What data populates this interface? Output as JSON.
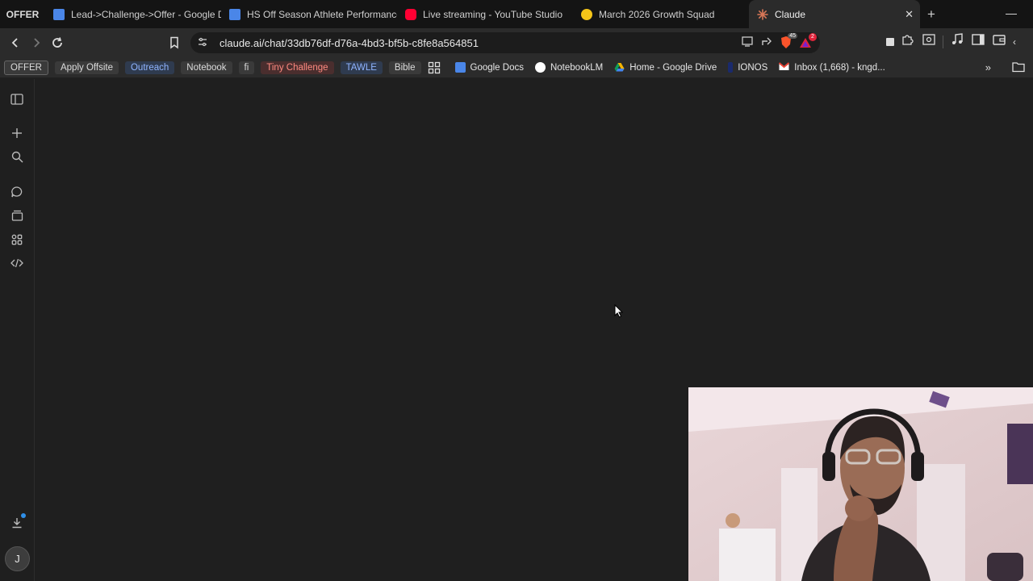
{
  "tabs": {
    "pinned_label": "OFFER",
    "items": [
      {
        "label": "Lead->Challenge->Offer - Google Dc",
        "icon": "google-docs-icon",
        "color": "#4a86e8"
      },
      {
        "label": "HS Off Season Athlete Performance F",
        "icon": "google-docs-icon",
        "color": "#4a86e8"
      },
      {
        "label": "Live streaming - YouTube Studio",
        "icon": "youtube-icon",
        "color": "#ff0033"
      },
      {
        "label": "March 2026 Growth Squad",
        "icon": "smiley-icon",
        "color": "#f5c518"
      },
      {
        "label": "Claude",
        "icon": "claude-icon",
        "color": "#d97757"
      }
    ],
    "new_tab": "+",
    "close": "✕"
  },
  "toolbar": {
    "url": "claude.ai/chat/33db76df-d76a-4bd3-bf5b-c8fe8a564851",
    "brave_badge": "45",
    "alert_badge": "2"
  },
  "bookmarks": {
    "chips": [
      {
        "label": "OFFER",
        "bg": "#3a3a3a",
        "fg": "#dcdcdc"
      },
      {
        "label": "Apply Offsite",
        "bg": "#3a3a3a",
        "fg": "#dcdcdc"
      },
      {
        "label": "Outreach",
        "bg": "#2f3b4f",
        "fg": "#8fb4ff"
      },
      {
        "label": "Notebook",
        "bg": "#3a3a3a",
        "fg": "#dcdcdc"
      },
      {
        "label": "fi",
        "bg": "#3a3a3a",
        "fg": "#dcdcdc"
      },
      {
        "label": "Tiny Challenge",
        "bg": "#4a2e2e",
        "fg": "#ff8a80"
      },
      {
        "label": "TAWLE",
        "bg": "#2f3b4f",
        "fg": "#8fb4ff"
      },
      {
        "label": "Bible",
        "bg": "#3a3a3a",
        "fg": "#dcdcdc"
      }
    ],
    "links": [
      {
        "label": "Google Docs",
        "icon": "google-docs-icon",
        "color": "#4a86e8"
      },
      {
        "label": "NotebookLM",
        "icon": "notebooklm-icon",
        "color": "#ffffff"
      },
      {
        "label": "Home - Google Drive",
        "icon": "google-drive-icon",
        "color": "#f4b400"
      },
      {
        "label": "IONOS",
        "icon": "ionos-icon",
        "color": "#1a2a6c"
      },
      {
        "label": "Inbox (1,668) - kngd...",
        "icon": "gmail-icon",
        "color": "#ea4335"
      }
    ],
    "more": "»"
  },
  "sidebar": {
    "avatar_initial": "J"
  }
}
